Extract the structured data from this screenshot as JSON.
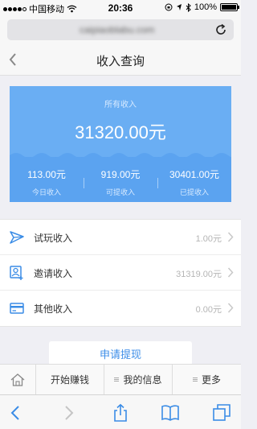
{
  "status_bar": {
    "carrier": "中国移动",
    "time": "20:36",
    "battery": "100%",
    "battery_level": 1.0
  },
  "url_bar": {
    "url": "caipiaoblabu.com"
  },
  "header": {
    "title": "收入查询"
  },
  "summary": {
    "label": "所有收入",
    "total": "31320.00元",
    "stats": [
      {
        "value": "113.00元",
        "label": "今日收入"
      },
      {
        "value": "919.00元",
        "label": "可提收入"
      },
      {
        "value": "30401.00元",
        "label": "已提收入"
      }
    ]
  },
  "income_list": [
    {
      "label": "试玩收入",
      "amount": "1.00元",
      "icon": "paper-plane-icon"
    },
    {
      "label": "邀请收入",
      "amount": "31319.00元",
      "icon": "invite-user-icon"
    },
    {
      "label": "其他收入",
      "amount": "0.00元",
      "icon": "card-icon"
    }
  ],
  "withdraw_button": "申请提现",
  "bottom_nav": {
    "items": [
      "开始赚钱",
      "我的信息",
      "更多"
    ]
  },
  "colors": {
    "accent": "#3d8ee8",
    "card": "#5ba3f0",
    "icon": "#3a8ce6"
  }
}
